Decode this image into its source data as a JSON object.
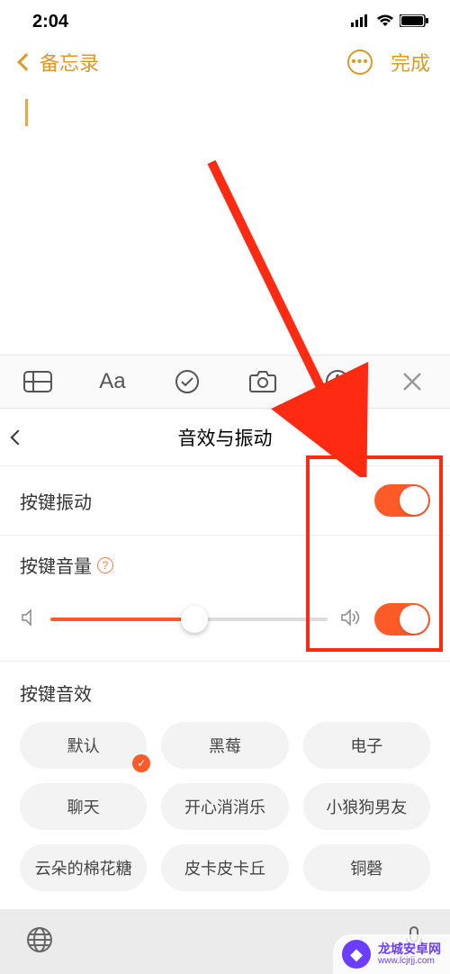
{
  "status": {
    "time": "2:04"
  },
  "nav": {
    "back": "备忘录",
    "done": "完成"
  },
  "toolbar": {
    "table": "table-icon",
    "text": "Aa",
    "check": "check-icon",
    "camera": "camera-icon",
    "marker": "marker-icon",
    "close": "close-icon"
  },
  "panel": {
    "title": "音效与振动"
  },
  "vibration": {
    "label": "按键振动",
    "on": true
  },
  "volume": {
    "label": "按键音量",
    "value": 52,
    "on": true
  },
  "effects": {
    "title": "按键音效",
    "rows": [
      [
        "默认",
        "黑莓",
        "电子"
      ],
      [
        "聊天",
        "开心消消乐",
        "小狼狗男友"
      ],
      [
        "云朵的棉花糖",
        "皮卡皮卡丘",
        "铜磬"
      ]
    ],
    "selected": "默认"
  },
  "watermark": {
    "title": "龙城安卓网",
    "url": "www.lcjrjj.com"
  }
}
